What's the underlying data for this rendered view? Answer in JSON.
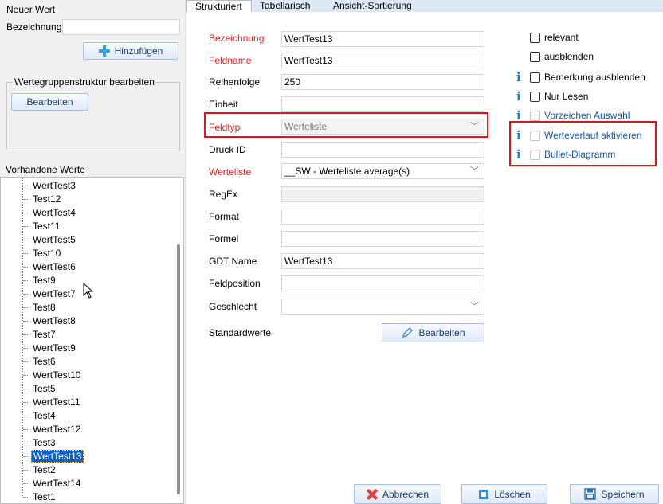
{
  "left": {
    "new_value_label": "Neuer Wert",
    "name_label": "Bezeichnung",
    "name_value": "",
    "add_button": "Hinzufügen",
    "group_legend": "Wertegruppenstruktur bearbeiten",
    "group_edit_button": "Bearbeiten",
    "existing_label": "Vorhandene Werte",
    "tree_items": [
      "WertTest3",
      "Test12",
      "WertTest4",
      "Test11",
      "WertTest5",
      "Test10",
      "WertTest6",
      "Test9",
      "WertTest7",
      "Test8",
      "WertTest8",
      "Test7",
      "WertTest9",
      "Test6",
      "WertTest10",
      "Test5",
      "WertTest11",
      "Test4",
      "WertTest12",
      "Test3",
      "WertTest13",
      "Test2",
      "WertTest14",
      "Test1"
    ],
    "selected_item": "WertTest13"
  },
  "tabs": [
    "Strukturiert",
    "Tabellarisch",
    "Ansicht-Sortierung"
  ],
  "active_tab": "Strukturiert",
  "form": {
    "bezeichnung_label": "Bezeichnung",
    "bezeichnung_value": "WertTest13",
    "feldname_label": "Feldname",
    "feldname_value": "WertTest13",
    "reihenfolge_label": "Reihenfolge",
    "reihenfolge_value": "250",
    "einheit_label": "Einheit",
    "einheit_value": "",
    "feldtyp_label": "Feldtyp",
    "feldtyp_value": "Werteliste",
    "druck_id_label": "Druck ID",
    "druck_id_value": "",
    "werteliste_label": "Werteliste",
    "werteliste_value": "__SW - Werteliste average(s)",
    "regex_label": "RegEx",
    "regex_value": "",
    "format_label": "Format",
    "format_value": "",
    "formel_label": "Formel",
    "formel_value": "",
    "gdt_name_label": "GDT Name",
    "gdt_name_value": "WertTest13",
    "feldposition_label": "Feldposition",
    "feldposition_value": "",
    "geschlecht_label": "Geschlecht",
    "geschlecht_value": "",
    "standardwerte_label": "Standardwerte",
    "edit_button": "Bearbeiten"
  },
  "checkboxes": {
    "relevant": "relevant",
    "ausblenden": "ausblenden",
    "bemerkung": "Bemerkung ausblenden",
    "nur_lesen": "Nur Lesen",
    "vorzeichen": "Vorzeichen Auswahl",
    "werteverlauf": "Werteverlauf aktivieren",
    "bullet": "Bullet-Diagramm",
    "info_glyph": "i"
  },
  "buttons": {
    "cancel": "Abbrechen",
    "delete": "Löschen",
    "save": "Speichern"
  },
  "colors": {
    "required_label": "#e02020",
    "highlight_box": "#e0141e",
    "info_icon": "#1c7ac8",
    "selection": "#0a64c8"
  }
}
